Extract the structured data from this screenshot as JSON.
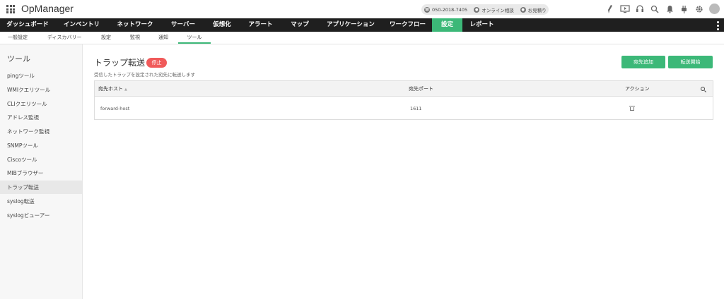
{
  "app": {
    "title": "OpManager"
  },
  "contact": {
    "phone": "050-2018-7405",
    "consult": "オンライン相談",
    "quote": "お見積り"
  },
  "main_nav": [
    {
      "label": "ダッシュボード",
      "active": false
    },
    {
      "label": "インベントリ",
      "active": false
    },
    {
      "label": "ネットワーク",
      "active": false
    },
    {
      "label": "サーバー",
      "active": false
    },
    {
      "label": "仮想化",
      "active": false
    },
    {
      "label": "アラート",
      "active": false
    },
    {
      "label": "マップ",
      "active": false
    },
    {
      "label": "アプリケーション",
      "active": false
    },
    {
      "label": "ワークフロー",
      "active": false
    },
    {
      "label": "設定",
      "active": true
    },
    {
      "label": "レポート",
      "active": false
    }
  ],
  "sub_nav": [
    {
      "label": "一般設定",
      "active": false
    },
    {
      "label": "ディスカバリー",
      "active": false
    },
    {
      "label": "設定",
      "active": false
    },
    {
      "label": "監視",
      "active": false
    },
    {
      "label": "通知",
      "active": false
    },
    {
      "label": "ツール",
      "active": true
    }
  ],
  "sidebar": {
    "title": "ツール",
    "items": [
      {
        "label": "pingツール",
        "active": false
      },
      {
        "label": "WMIクエリツール",
        "active": false
      },
      {
        "label": "CLIクエリツール",
        "active": false
      },
      {
        "label": "アドレス監視",
        "active": false
      },
      {
        "label": "ネットワーク監視",
        "active": false
      },
      {
        "label": "SNMPツール",
        "active": false
      },
      {
        "label": "Ciscoツール",
        "active": false
      },
      {
        "label": "MIBブラウザー",
        "active": false
      },
      {
        "label": "トラップ転送",
        "active": true
      },
      {
        "label": "syslog転送",
        "active": false
      },
      {
        "label": "syslogビューアー",
        "active": false
      }
    ]
  },
  "page": {
    "title": "トラップ転送",
    "status": "停止",
    "description": "受信したトラップを設定された宛先に転送します",
    "add_button": "宛先追加",
    "start_button": "転送開始"
  },
  "table": {
    "columns": {
      "host": "宛先ホスト",
      "port": "宛先ポート",
      "action": "アクション"
    },
    "rows": [
      {
        "host": "forward-host",
        "port": "1611"
      }
    ]
  },
  "colors": {
    "accent": "#3cb878",
    "danger": "#f05a5a",
    "nav_bg": "#1f1f1f"
  }
}
